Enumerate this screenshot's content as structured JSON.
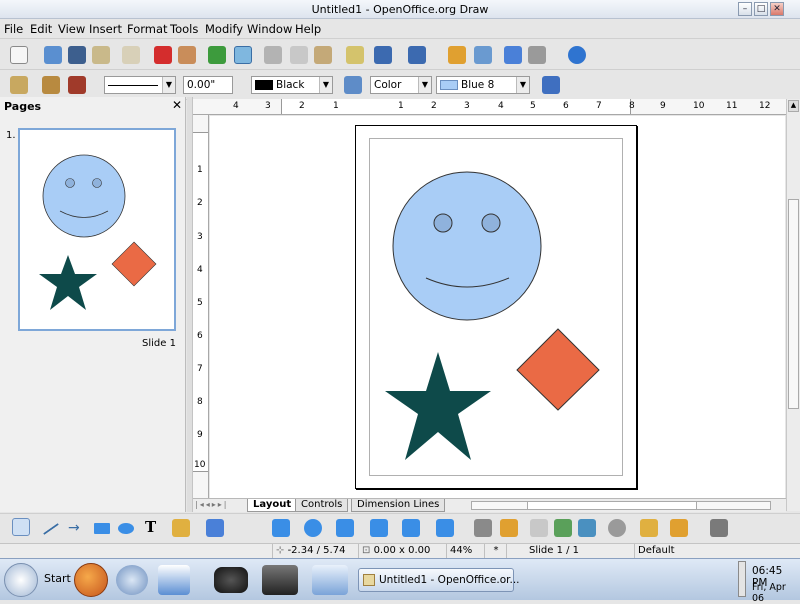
{
  "window": {
    "title": "Untitled1 - OpenOffice.org Draw"
  },
  "menu": [
    "File",
    "Edit",
    "View",
    "Insert",
    "Format",
    "Tools",
    "Modify",
    "Window",
    "Help"
  ],
  "lines_toolbar": {
    "width_value": "0.00\"",
    "line_color": "Black",
    "area_style": "Color",
    "area_color": "Blue 8"
  },
  "pages_panel": {
    "title": "Pages",
    "slide_number": "1.",
    "slide_label": "Slide 1"
  },
  "ruler": {
    "top_ticks": [
      "4",
      "3",
      "2",
      "1",
      "1",
      "2",
      "3",
      "4",
      "5",
      "6",
      "7",
      "8",
      "9",
      "10",
      "11",
      "12"
    ],
    "left_ticks": [
      "1",
      "2",
      "3",
      "4",
      "5",
      "6",
      "7",
      "8",
      "9",
      "10"
    ]
  },
  "tabs": [
    "Layout",
    "Controls",
    "Dimension Lines"
  ],
  "status": {
    "position": "-2.34 / 5.74",
    "size": "0.00 x 0.00",
    "zoom": "44%",
    "modified": "*",
    "slide": "Slide 1 / 1",
    "layout": "Default"
  },
  "taskbar": {
    "start_label": "Start",
    "task_label": "Untitled1 - OpenOffice.or...",
    "time": "06:45 PM",
    "date": "Fri, Apr 06"
  },
  "colors": {
    "face": "#a9cdf6",
    "star": "#0e4a4a",
    "diamond": "#ea6a45",
    "selection": "#2f6fbd"
  }
}
